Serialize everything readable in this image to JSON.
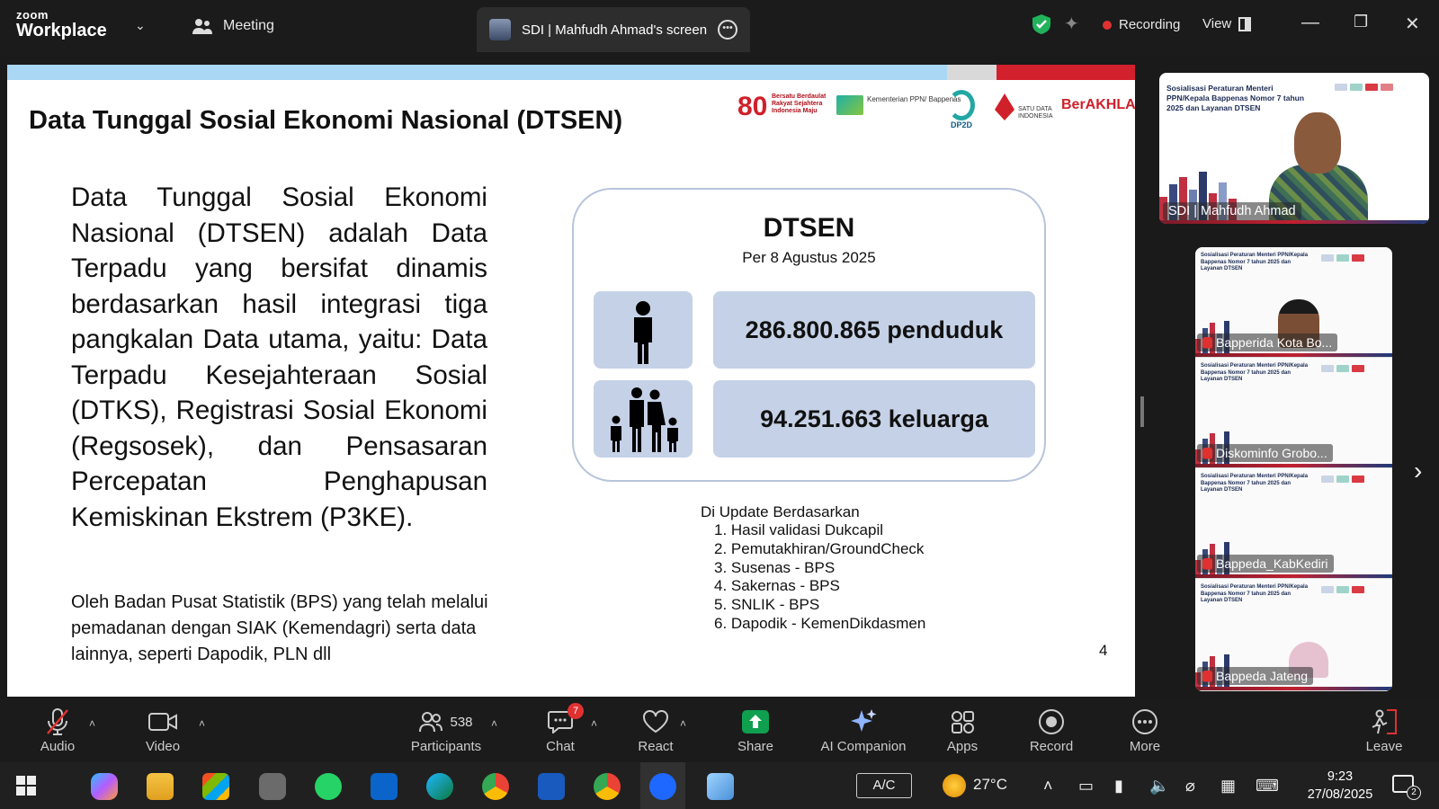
{
  "app": {
    "brand_small": "zoom",
    "brand_big": "Workplace",
    "meeting_label": "Meeting",
    "screen_tab_label": "SDI | Mahfudh Ahmad's screen",
    "recording_label": "Recording",
    "view_label": "View",
    "accent_color": "#0b5cff",
    "recording_color": "#e03131"
  },
  "slide": {
    "title": "Data Tunggal Sosial Ekonomi Nasional (DTSEN)",
    "logos": {
      "eighty_number": "80",
      "eighty_text": "Bersatu Berdaulat Rakyat Sejahtera Indonesia Maju",
      "kementerian": "Kementerian PPN/ Bappenas",
      "dp2d": "DP2D",
      "satu_data": "SATU DATA INDONESIA",
      "berakhlak": "BerAKHLAK"
    },
    "paragraph": "Data Tunggal Sosial Ekonomi Nasional (DTSEN) adalah Data Terpadu yang bersifat dinamis berdasarkan hasil integrasi tiga pangkalan Data utama, yaitu: Data Terpadu Kesejahteraan Sosial (DTKS), Registrasi Sosial Ekonomi (Regsosek), dan Pensasaran Percepatan Penghapusan Kemiskinan Ekstrem (P3KE).",
    "note": "Oleh Badan Pusat Statistik (BPS) yang telah melalui pemadanan dengan SIAK (Kemendagri) serta data lainnya, seperti Dapodik, PLN dll",
    "box": {
      "title": "DTSEN",
      "subtitle": "Per 8 Agustus 2025",
      "stat_population": "286.800.865 penduduk",
      "stat_family": "94.251.663 keluarga"
    },
    "update_heading": "Di Update Berdasarkan",
    "update_items": [
      "1.  Hasil validasi Dukcapil",
      "2.  Pemutakhiran/GroundCheck",
      "3.  Susenas - BPS",
      "4.  Sakernas - BPS",
      "5.  SNLIK - BPS",
      "6.  Dapodik - KemenDikdasmen"
    ],
    "page_number": "4"
  },
  "video": {
    "mini_slide_title": "Sosialisasi Peraturan Menteri PPN/Kepala Bappenas Nomor 7 tahun 2025 dan Layanan DTSEN",
    "speaker_name": "SDI | Mahfudh Ahmad",
    "gallery": [
      "Bapperida Kota Bo...",
      "Diskominfo Grobo...",
      "Bappeda_KabKediri",
      "Bappeda Jateng"
    ]
  },
  "toolbar": {
    "audio": "Audio",
    "video": "Video",
    "participants": "Participants",
    "participant_count": "538",
    "chat": "Chat",
    "chat_badge": "7",
    "react": "React",
    "share": "Share",
    "ai_companion": "AI Companion",
    "apps": "Apps",
    "record": "Record",
    "more": "More",
    "leave": "Leave",
    "share_color": "#0e9f4f"
  },
  "taskbar": {
    "ac_label": "A/C",
    "temperature": "27°C",
    "time": "9:23",
    "date": "27/08/2025",
    "notification_count": "2"
  }
}
